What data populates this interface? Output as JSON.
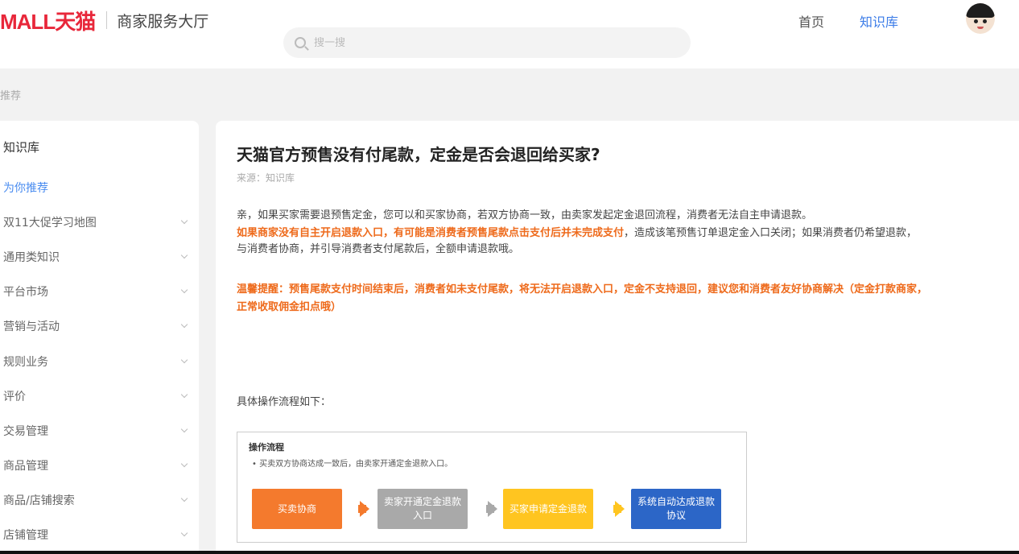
{
  "header": {
    "logo": "MALL天猫",
    "subtitle": "商家服务大厅",
    "search_placeholder": "搜一搜",
    "nav_home": "首页",
    "nav_kb": "知识库"
  },
  "breadcrumb": "推荐",
  "sidebar": {
    "title": "知识库",
    "items": [
      {
        "label": "为你推荐"
      },
      {
        "label": "双11大促学习地图"
      },
      {
        "label": "通用类知识"
      },
      {
        "label": "平台市场"
      },
      {
        "label": "营销与活动"
      },
      {
        "label": "规则业务"
      },
      {
        "label": "评价"
      },
      {
        "label": "交易管理"
      },
      {
        "label": "商品管理"
      },
      {
        "label": "商品/店铺搜索"
      },
      {
        "label": "店铺管理"
      }
    ]
  },
  "article": {
    "title": "天猫官方预售没有付尾款，定金是否会退回给买家?",
    "source": "来源：知识库",
    "p1": "亲，如果买家需要退预售定金，您可以和买家协商，若双方协商一致，由卖家发起定金退回流程，消费者无法自主申请退款。",
    "p2_orange": "如果商家没有自主开启退款入口，有可能是消费者预售尾款点击支付后并未完成支付",
    "p2_normal": "，造成该笔预售订单退定金入口关闭；如果消费者仍希望退款，",
    "p3": "与消费者协商，并引导消费者支付尾款后，全额申请退款哦。",
    "p4": "温馨提醒：预售尾款支付时间结束后，消费者如未支付尾款，将无法开启退款入口，定金不支持退回，建议您和消费者友好协商解决（定金打款商家，",
    "p5": "正常收取佣金扣点哦）",
    "steps_intro": "具体操作流程如下：",
    "flow": {
      "title": "操作流程",
      "note": "• 买卖双方协商达成一致后，由卖家开通定金退款入口。",
      "steps": [
        "买卖协商",
        "卖家开通定金退款入口",
        "买家申请定金退款",
        "系统自动达成退款协议"
      ]
    }
  },
  "colors": {
    "brand": "#e8273a",
    "accent": "#3d7de8",
    "warning": "#ee6a1b",
    "step1": "#f47a2d",
    "step2": "#a9a9a9",
    "step3": "#ffc520",
    "step4": "#2c66c7"
  }
}
